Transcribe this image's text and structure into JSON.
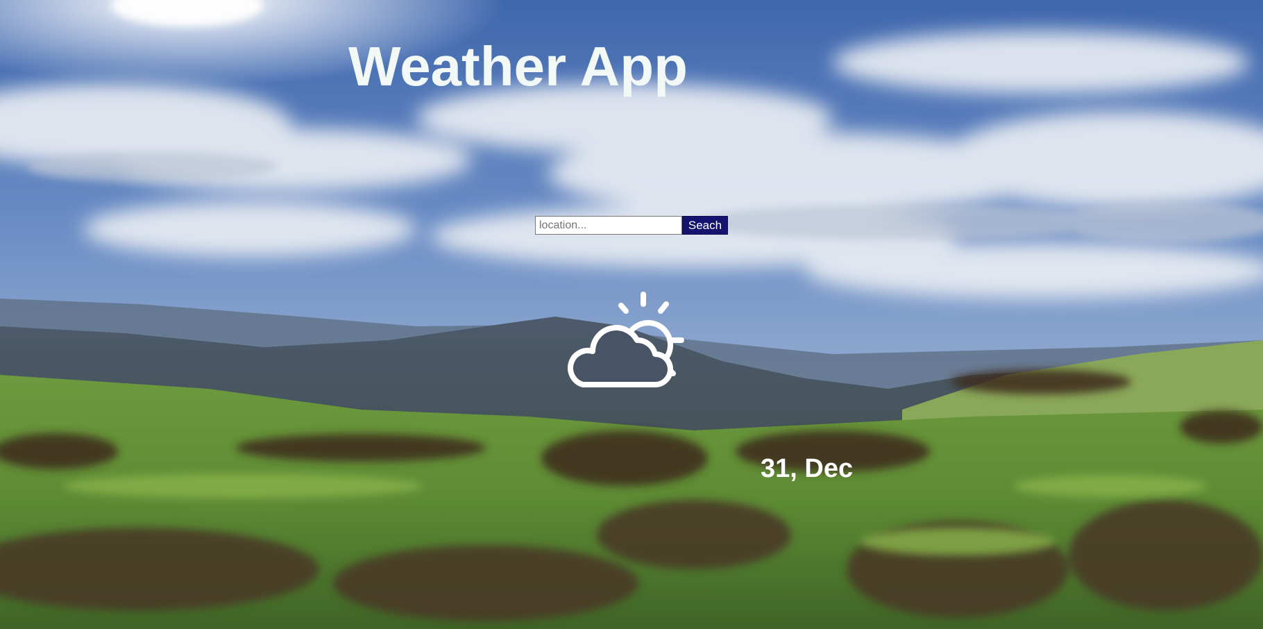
{
  "header": {
    "title": "Weather App"
  },
  "search": {
    "placeholder": "location...",
    "value": "",
    "button_label": "Seach"
  },
  "weather": {
    "icon": "partly-cloudy-day-icon",
    "date": "31, Dec"
  },
  "colors": {
    "title_text": "#f1f8f6",
    "button_bg": "#141470",
    "date_text": "#ffffff"
  }
}
